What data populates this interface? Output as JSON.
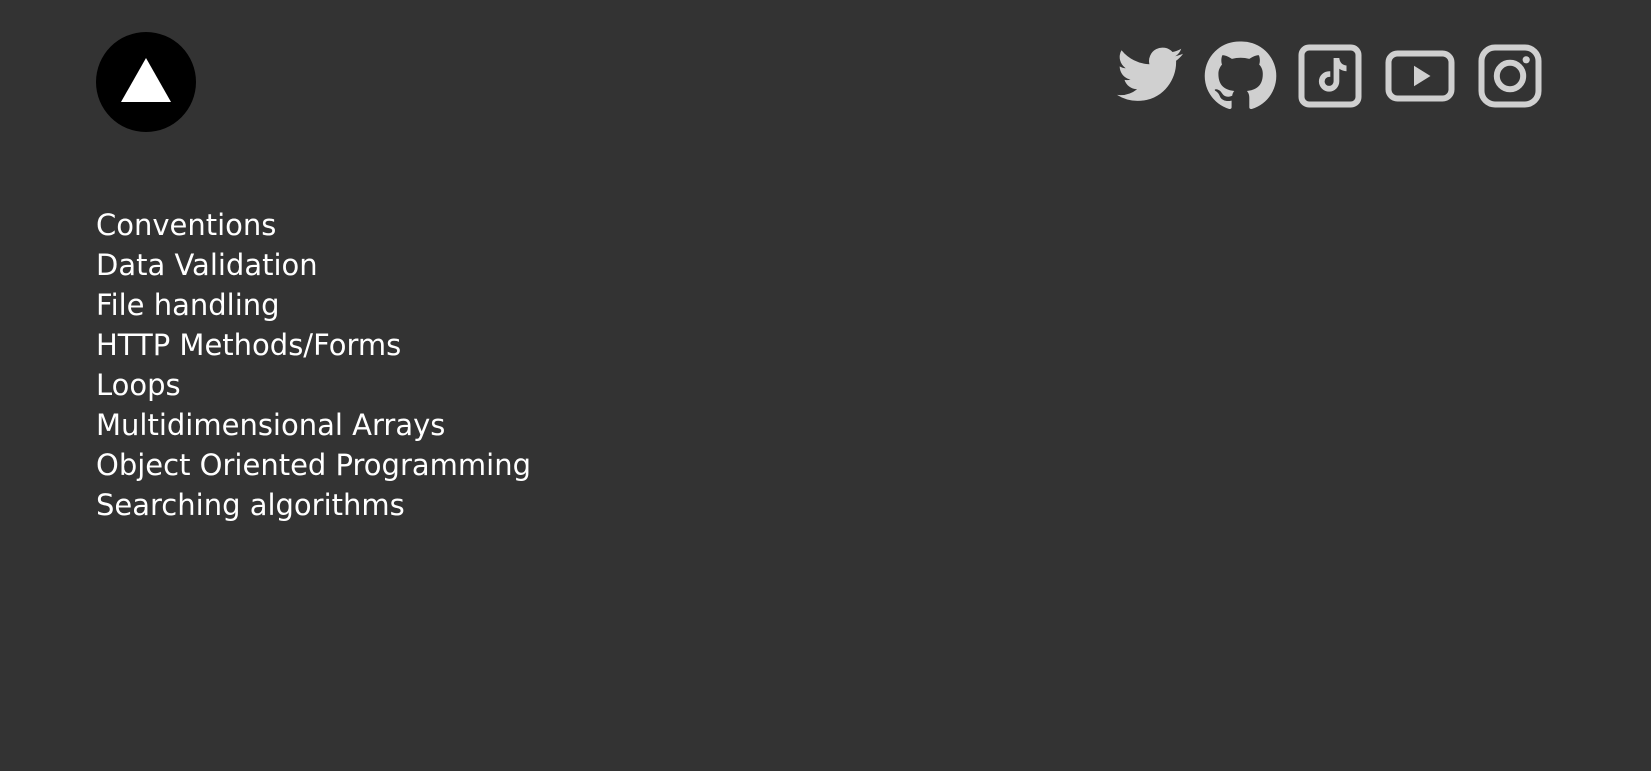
{
  "header": {
    "logo_icon": "triangle-up-icon",
    "socials": [
      {
        "name": "twitter-icon"
      },
      {
        "name": "github-icon"
      },
      {
        "name": "tiktok-icon"
      },
      {
        "name": "youtube-icon"
      },
      {
        "name": "instagram-icon"
      }
    ]
  },
  "nav": {
    "links": [
      "Conventions",
      "Data Validation",
      "File handling",
      "HTTP Methods/Forms",
      "Loops",
      "Multidimensional Arrays",
      "Object Oriented Programming",
      "Searching algorithms"
    ]
  },
  "colors": {
    "background": "#333333",
    "text": "#ffffff",
    "icon": "#d0d0d0",
    "logo_bg": "#000000"
  }
}
